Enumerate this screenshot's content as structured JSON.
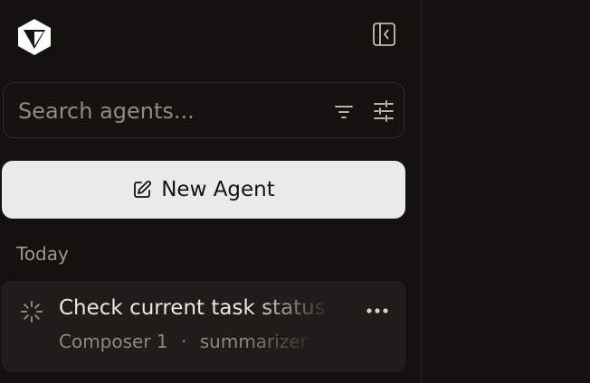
{
  "sidebar": {
    "logo_icon": "cube-logo-icon",
    "collapse_icon": "sidebar-collapse-icon",
    "search": {
      "placeholder": "Search agents...",
      "value": "",
      "filter_icon": "filter-icon",
      "settings_icon": "sliders-icon"
    },
    "new_agent": {
      "label": "New Agent",
      "icon": "edit-icon"
    },
    "sections": [
      {
        "label": "Today",
        "items": [
          {
            "title": "Check current task status",
            "model": "Composer 1",
            "separator": "·",
            "subtitle": "summarizer",
            "status_icon": "spinner-icon",
            "menu_icon": "more-horizontal-icon"
          }
        ]
      }
    ]
  },
  "colors": {
    "background": "#14120e",
    "button_bg": "#eaeaea",
    "text_primary": "#ece8e1",
    "text_muted": "#8f8b84"
  }
}
